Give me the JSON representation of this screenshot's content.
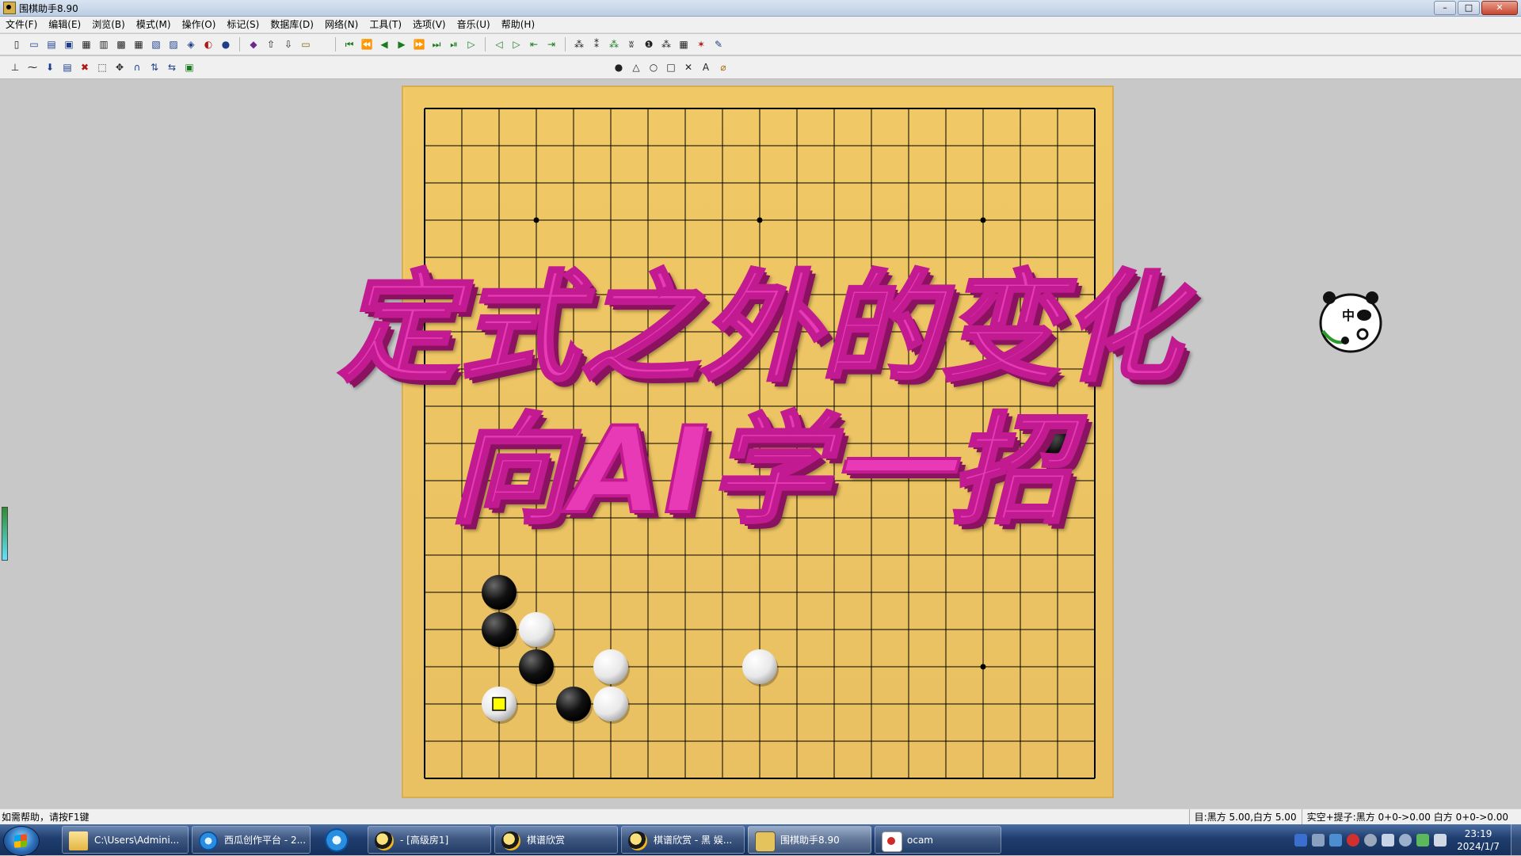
{
  "window": {
    "title": "围棋助手8.90",
    "controls": {
      "minimize": "–",
      "maximize": "□",
      "close": "✕"
    }
  },
  "menu": [
    "文件(F)",
    "编辑(E)",
    "浏览(B)",
    "模式(M)",
    "操作(O)",
    "标记(S)",
    "数据库(D)",
    "网络(N)",
    "工具(T)",
    "选项(V)",
    "音乐(U)",
    "帮助(H)"
  ],
  "toolbar_marks": {
    "triangle": "△",
    "circle": "○",
    "square": "□",
    "cross": "✕",
    "letter": "A"
  },
  "overlay": {
    "line1": "定式之外的变化",
    "line2": "向AI学一招"
  },
  "board": {
    "size": 19,
    "stones": [
      {
        "col": 2,
        "row": 13,
        "color": "black"
      },
      {
        "col": 2,
        "row": 14,
        "color": "black"
      },
      {
        "col": 3,
        "row": 14,
        "color": "white"
      },
      {
        "col": 3,
        "row": 15,
        "color": "black"
      },
      {
        "col": 5,
        "row": 15,
        "color": "white"
      },
      {
        "col": 9,
        "row": 15,
        "color": "white"
      },
      {
        "col": 2,
        "row": 16,
        "color": "white",
        "marked": true
      },
      {
        "col": 4,
        "row": 16,
        "color": "black"
      },
      {
        "col": 5,
        "row": 16,
        "color": "white"
      },
      {
        "col": 17,
        "row": 9,
        "color": "black"
      }
    ],
    "colors": {
      "wood": "#eec86a",
      "line": "#000000",
      "marker": "#ffff00"
    }
  },
  "sticker": {
    "text": "中"
  },
  "statusbar": {
    "help": "如需帮助，请按F1键",
    "score": "目:黑方 5.00,白方 5.00",
    "captures": "实空+提子:黑方 0+0->0.00 白方 0+0->0.00"
  },
  "taskbar": {
    "tasks": [
      {
        "label": "C:\\Users\\Admini...",
        "icon": "folder-icon"
      },
      {
        "label": "西瓜创作平台 - 2...",
        "icon": "ie-icon"
      },
      {
        "label": "- [高级房1]",
        "icon": "weiqi-icon"
      },
      {
        "label": "棋谱欣赏",
        "icon": "weiqi-icon"
      },
      {
        "label": "棋谱欣赏 - 黑 娱...",
        "icon": "weiqi-icon"
      },
      {
        "label": "围棋助手8.90",
        "icon": "board-icon"
      },
      {
        "label": "ocam",
        "icon": "ocam-icon"
      }
    ],
    "clock": {
      "time": "23:19",
      "date": "2024/1/7"
    }
  }
}
